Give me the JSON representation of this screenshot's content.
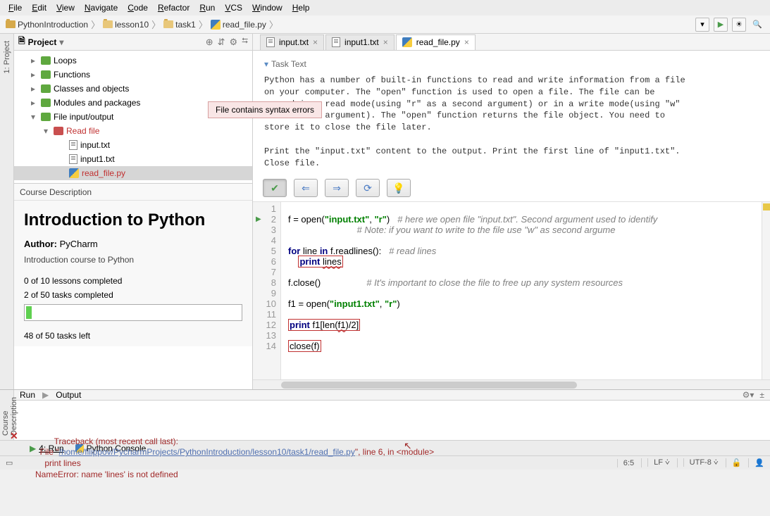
{
  "menu": {
    "file": "File",
    "edit": "Edit",
    "view": "View",
    "navigate": "Navigate",
    "code": "Code",
    "refactor": "Refactor",
    "run": "Run",
    "vcs": "VCS",
    "window": "Window",
    "help": "Help"
  },
  "breadcrumbs": {
    "proj": "PythonIntroduction",
    "lesson": "lesson10",
    "task": "task1",
    "file": "read_file.py"
  },
  "project": {
    "header": "Project",
    "items": {
      "loops": "Loops",
      "functions": "Functions",
      "classes": "Classes and objects",
      "modules": "Modules and packages",
      "fileio": "File input/output",
      "readfile": "Read file",
      "input": "input.txt",
      "input1": "input1.txt",
      "readpy": "read_file.py"
    }
  },
  "course": {
    "hdr": "Course Description",
    "title": "Introduction to Python",
    "author_label": "Author:",
    "author": "PyCharm",
    "sub": "Introduction course to Python",
    "lessons": "0 of 10 lessons completed",
    "tasks": "2 of 50 tasks completed",
    "left": "48 of 50 tasks left"
  },
  "tabs": {
    "t1": "input.txt",
    "t2": "input1.txt",
    "t3": "read_file.py"
  },
  "task": {
    "hdr": "Task Text",
    "body": "Python has a number of built-in functions to read and write information from a file\non your computer. The \"open\" function is used to open a file. The file can be\nopened in a read mode(using \"r\" as a second argument) or in a write mode(using \"w\"\nas a second argument). The \"open\" function returns the file object. You need to\nstore it to close the file later.\n\nPrint the \"input.txt\" content to the output. Print the first line of \"input1.txt\".\nClose file."
  },
  "tooltip": "File contains syntax errors",
  "code": {
    "lines": [
      "1",
      "2",
      "3",
      "4",
      "5",
      "6",
      "7",
      "8",
      "9",
      "10",
      "11",
      "12",
      "13",
      "14"
    ]
  },
  "run": {
    "tab1": "Run",
    "tab2": "Output",
    "trace": "Traceback (most recent call last):",
    "file_pre": "  File \"",
    "file_link": "/home/filippov/PycharmProjects/PythonIntroduction/lesson10/task1/read_file.py",
    "file_post": "\", line 6, in <module>",
    "print": "    print lines",
    "err": "NameError: name 'lines' is not defined"
  },
  "bottom_tabs": {
    "run": "4: Run",
    "console": "Python Console"
  },
  "status": {
    "pos": "6:5",
    "le": "LF",
    "enc": "UTF-8"
  }
}
